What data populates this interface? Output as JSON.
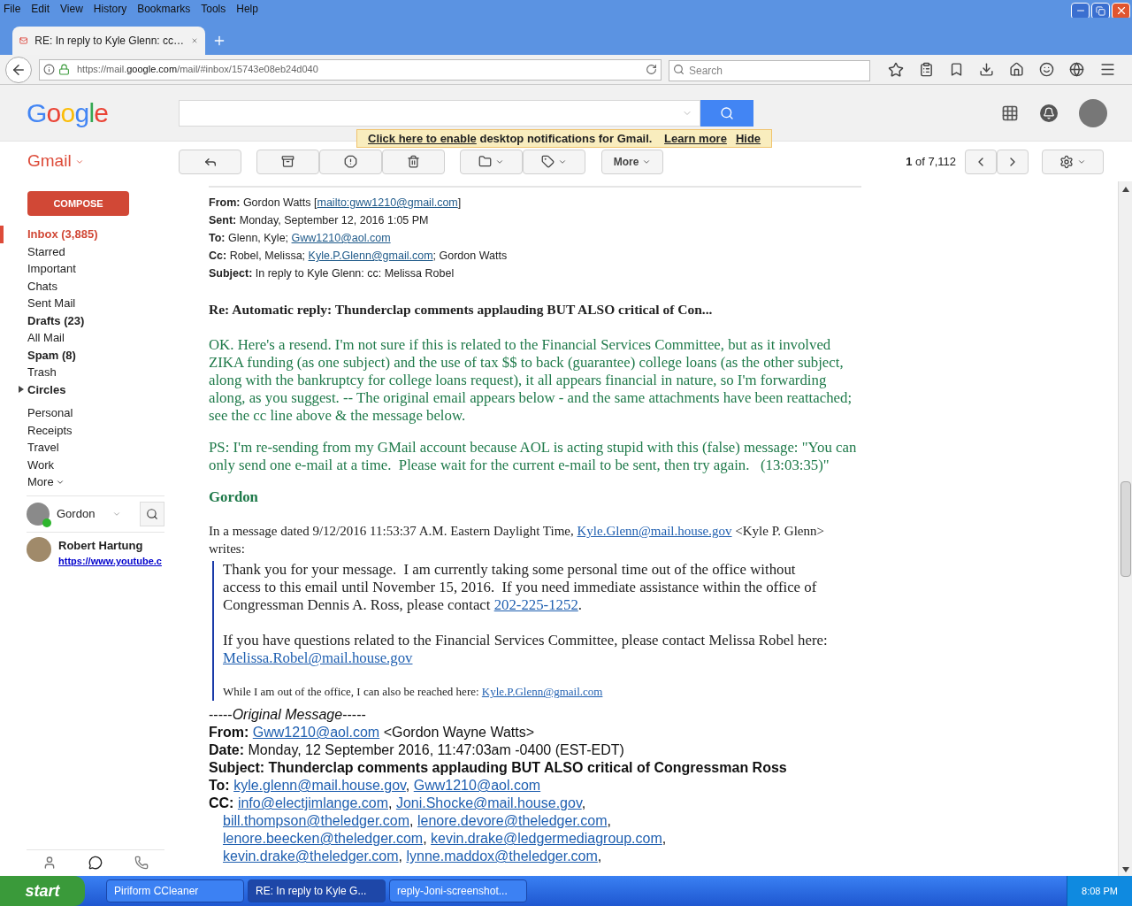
{
  "browser": {
    "menu": [
      "File",
      "Edit",
      "View",
      "History",
      "Bookmarks",
      "Tools",
      "Help"
    ],
    "tab": {
      "title": "RE: In reply to Kyle Glenn: cc…",
      "selected": true
    },
    "url": {
      "host": "https://mail.",
      "domain": "google.com",
      "path": "/mail/#inbox/15743e08eb24d040"
    },
    "search": {
      "placeholder": "Search"
    }
  },
  "gmail": {
    "logo": "Google",
    "app_label": "Gmail",
    "notification": [
      {
        "kind": "link",
        "text": "Click here to enable"
      },
      {
        "kind": "text",
        "text": " desktop notifications for Gmail. "
      },
      {
        "kind": "link",
        "text": "Learn more"
      },
      {
        "kind": "link",
        "text": "Hide"
      }
    ],
    "toolbar": {
      "more": "More",
      "count": "**1** of 7,112"
    }
  },
  "sidebar": {
    "compose": "COMPOSE",
    "items": [
      {
        "kind": "folder",
        "label": "Inbox (3,885)",
        "selected": true,
        "unread": true
      },
      {
        "kind": "folder",
        "label": "Starred",
        "selected": false,
        "unread": false
      },
      {
        "kind": "folder",
        "label": "Important",
        "selected": false,
        "unread": false
      },
      {
        "kind": "folder",
        "label": "Chats",
        "selected": false,
        "unread": false
      },
      {
        "kind": "folder",
        "label": "Sent Mail",
        "selected": false,
        "unread": false
      },
      {
        "kind": "folder",
        "label": "Drafts (23)",
        "selected": false,
        "unread": true
      },
      {
        "kind": "folder",
        "label": "All Mail",
        "selected": false,
        "unread": false
      },
      {
        "kind": "folder",
        "label": "Spam (8)",
        "selected": false,
        "unread": true
      },
      {
        "kind": "folder",
        "label": "Trash",
        "selected": false,
        "unread": false
      },
      {
        "kind": "group",
        "label": "Circles",
        "selected": false,
        "unread": true,
        "expanded": false
      },
      {
        "kind": "folder",
        "label": "Personal",
        "selected": false,
        "unread": false
      },
      {
        "kind": "folder",
        "label": "Receipts",
        "selected": false,
        "unread": false
      },
      {
        "kind": "folder",
        "label": "Travel",
        "selected": false,
        "unread": false
      },
      {
        "kind": "folder",
        "label": "Work",
        "selected": false,
        "unread": false
      },
      {
        "kind": "more",
        "label": "More"
      }
    ],
    "chat": {
      "user": {
        "name": "Gordon",
        "color": "#2db52d"
      },
      "contacts": [
        {
          "name": "Robert Hartung",
          "status": "https://www.youtube.c"
        }
      ]
    }
  },
  "email": {
    "header_lines": [
      {
        "segments": [
          {
            "kind": "label",
            "text": "From: "
          },
          {
            "kind": "text",
            "text": "Gordon Watts ["
          },
          {
            "kind": "link",
            "text": "mailto:gww1210@gmail.com"
          },
          {
            "kind": "text",
            "text": "]"
          }
        ]
      },
      {
        "segments": [
          {
            "kind": "label",
            "text": "Sent: "
          },
          {
            "kind": "text",
            "text": "Monday, September 12, 2016 1:05 PM"
          }
        ]
      },
      {
        "segments": [
          {
            "kind": "label",
            "text": "To: "
          },
          {
            "kind": "text",
            "text": "Glenn, Kyle; "
          },
          {
            "kind": "link",
            "text": "Gww1210@aol.com"
          }
        ]
      },
      {
        "segments": [
          {
            "kind": "label",
            "text": "Cc: "
          },
          {
            "kind": "text",
            "text": "Robel, Melissa; "
          },
          {
            "kind": "link",
            "text": "Kyle.P.Glenn@gmail.com"
          },
          {
            "kind": "text",
            "text": "; Gordon Watts"
          }
        ]
      },
      {
        "segments": [
          {
            "kind": "label",
            "text": "Subject: "
          },
          {
            "kind": "text",
            "text": "In reply to Kyle Glenn: cc: Melissa Robel"
          }
        ]
      }
    ],
    "title": "Re: Automatic reply: Thunderclap comments applauding BUT ALSO critical of Con...",
    "paragraphs": [
      "OK. Here's a resend. I'm not sure if this is related to the Financial Services Committee, but as it involved ZIKA funding (as one subject) and the use of tax $$ to back (guarantee) college loans (as the other subject, along with the bankruptcy for college loans request), it all appears financial in nature, so I'm forwarding along, as you suggest. -- The original email appears below - and the same attachments have been reattached; see the cc line above & the message below.",
      "PS: I'm re-sending from my GMail account because AOL is acting stupid with this (false) message: \"You can only send one e-mail at a time.  Please wait for the current e-mail to be sent, then try again.   (13:03:35)\"",
      "Gordon"
    ],
    "quote_intro": [
      {
        "kind": "text",
        "text": "In a message dated 9/12/2016 11:53:37 A.M. Eastern Daylight Time, "
      },
      {
        "kind": "link",
        "text": "Kyle.Glenn@mail.house.gov"
      },
      {
        "kind": "text",
        "text": " <Kyle P. Glenn> writes:"
      }
    ],
    "quote": [
      {
        "kind": "paragraph",
        "segments": [
          {
            "kind": "text",
            "text": "Thank you for your message.  I am currently taking some personal time out of the office without access to this email until November 15, 2016.  If you need immediate assistance within the office of Congressman Dennis A. Ross, please contact "
          },
          {
            "kind": "link",
            "text": "202-225-1252"
          },
          {
            "kind": "text",
            "text": "."
          }
        ]
      },
      {
        "kind": "paragraph",
        "segments": [
          {
            "kind": "text",
            "text": "If you have questions related to the Financial Services Committee, please contact Melissa Robel here: "
          },
          {
            "kind": "link",
            "text": "Melissa.Robel@mail.house.gov"
          }
        ]
      },
      {
        "kind": "note",
        "segments": [
          {
            "kind": "text",
            "text": "While I am out of the office, I can also be reached here: "
          },
          {
            "kind": "link",
            "text": "Kyle.P.Glenn@gmail.com"
          }
        ]
      }
    ],
    "original": {
      "heading": "-----*Original Message*-----",
      "lines": [
        {
          "segments": [
            {
              "kind": "label",
              "text": "From: "
            },
            {
              "kind": "link",
              "text": "Gww1210@aol.com"
            },
            {
              "kind": "text",
              "text": " <Gordon Wayne Watts>"
            }
          ]
        },
        {
          "segments": [
            {
              "kind": "label",
              "text": "Date: "
            },
            {
              "kind": "text",
              "text": "Monday, 12 September 2016, 11:47:03am -0400 (EST-EDT)"
            }
          ]
        },
        {
          "segments": [
            {
              "kind": "label",
              "text": "Subject: Thunderclap comments applauding BUT ALSO critical of Congressman Ross"
            }
          ]
        },
        {
          "segments": [
            {
              "kind": "label",
              "text": "To: "
            },
            {
              "kind": "link",
              "text": "kyle.glenn@mail.house.gov",
              "after": ", "
            },
            {
              "kind": "link",
              "text": "Gww1210@aol.com"
            }
          ]
        },
        {
          "segments": [
            {
              "kind": "label",
              "text": "CC: "
            },
            {
              "kind": "link",
              "text": "info@electjimlange.com",
              "after": ", "
            },
            {
              "kind": "link",
              "text": "Joni.Shocke@mail.house.gov",
              "after": ","
            }
          ]
        },
        {
          "indent": true,
          "segments": [
            {
              "kind": "link",
              "text": "bill.thompson@theledger.com",
              "after": ", "
            },
            {
              "kind": "link",
              "text": "lenore.devore@theledger.com",
              "after": ","
            }
          ]
        },
        {
          "indent": true,
          "segments": [
            {
              "kind": "link",
              "text": "lenore.beecken@theledger.com",
              "after": ", "
            },
            {
              "kind": "link",
              "text": "kevin.drake@ledgermediagroup.com",
              "after": ","
            }
          ]
        },
        {
          "indent": true,
          "segments": [
            {
              "kind": "link",
              "text": "kevin.drake@theledger.com",
              "after": ", "
            },
            {
              "kind": "link",
              "text": "lynne.maddox@theledger.com",
              "after": ","
            }
          ]
        }
      ]
    }
  },
  "taskbar": {
    "start": "start",
    "items": [
      {
        "label": "Piriform CCleaner",
        "selected": false
      },
      {
        "label": "RE: In reply to Kyle G...",
        "selected": true
      },
      {
        "label": "reply-Joni-screenshot...",
        "selected": false
      }
    ],
    "time": "8:08 PM"
  }
}
